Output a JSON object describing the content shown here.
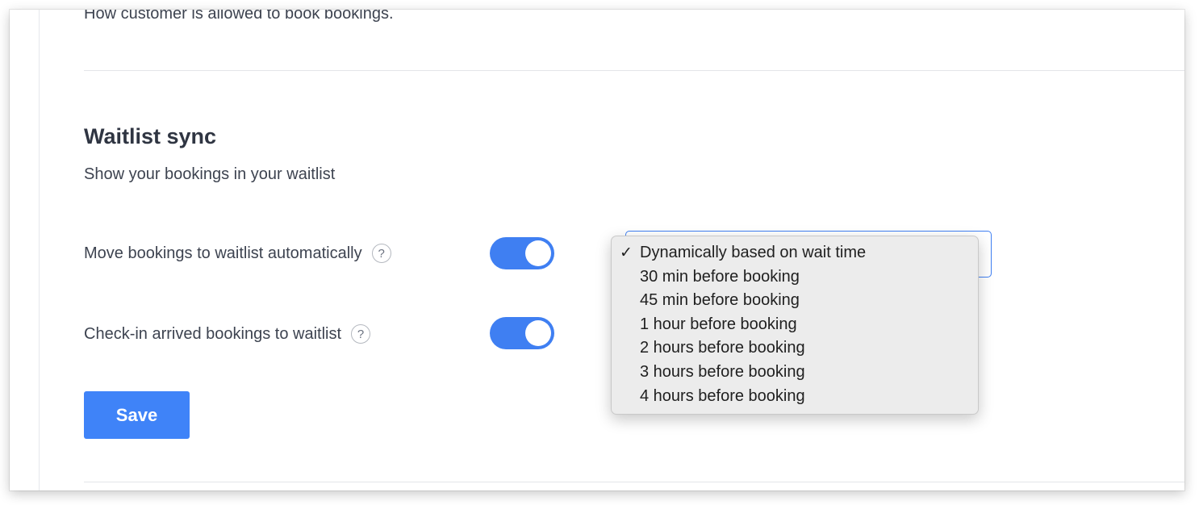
{
  "previous_section": {
    "description": "How customer is allowed to book bookings."
  },
  "waitlist_sync": {
    "title": "Waitlist sync",
    "description": "Show your bookings in your waitlist",
    "settings": [
      {
        "label": "Move bookings to waitlist automatically",
        "help": "?",
        "enabled": true
      },
      {
        "label": "Check-in arrived bookings to waitlist",
        "help": "?",
        "enabled": true
      }
    ],
    "timing_select": {
      "selected": "Dynamically based on wait time",
      "check_mark": "✓",
      "options": [
        "Dynamically based on wait time",
        "30 min before booking",
        "45 min before booking",
        "1 hour before booking",
        "2 hours before booking",
        "3 hours before booking",
        "4 hours before booking"
      ]
    },
    "save_label": "Save"
  },
  "colors": {
    "accent": "#3f83f8",
    "toggle_on": "#3f7ff2",
    "text": "#3d4350",
    "heading": "#2f3542",
    "menu_bg": "#ececec"
  }
}
